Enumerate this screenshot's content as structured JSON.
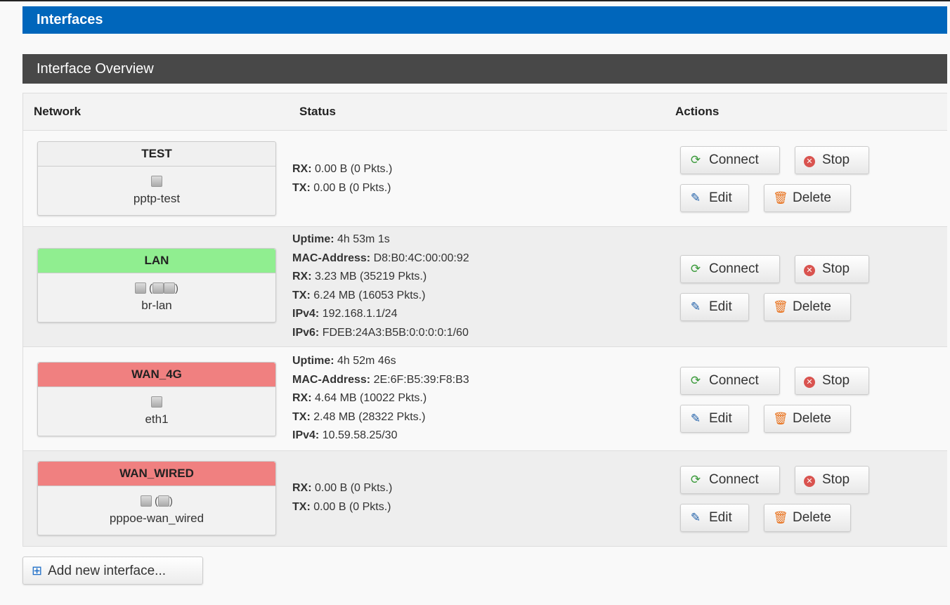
{
  "page": {
    "title": "Interfaces"
  },
  "section": {
    "title": "Interface Overview"
  },
  "table": {
    "headers": {
      "network": "Network",
      "status": "Status",
      "actions": "Actions"
    }
  },
  "colors": {
    "lan_header": "#90ee90",
    "wan_header": "#f08080",
    "neutral_header": "#f0f0f0",
    "page_header": "#0066bb"
  },
  "actions": {
    "connect": "Connect",
    "stop": "Stop",
    "edit": "Edit",
    "delete": "Delete"
  },
  "labels": {
    "uptime": "Uptime:",
    "mac": "MAC-Address:",
    "rx": "RX:",
    "tx": "TX:",
    "ipv4": "IPv4:",
    "ipv6": "IPv6:"
  },
  "interfaces": [
    {
      "name": "TEST",
      "device": "pptp-test",
      "rx": "0.00 B (0 Pkts.)",
      "tx": "0.00 B (0 Pkts.)"
    },
    {
      "name": "LAN",
      "device": "br-lan",
      "uptime": "4h 53m 1s",
      "mac": "D8:B0:4C:00:00:92",
      "rx": "3.23 MB (35219 Pkts.)",
      "tx": "6.24 MB (16053 Pkts.)",
      "ipv4": "192.168.1.1/24",
      "ipv6": "FDEB:24A3:B5B:0:0:0:0:1/60"
    },
    {
      "name": "WAN_4G",
      "device": "eth1",
      "uptime": "4h 52m 46s",
      "mac": "2E:6F:B5:39:F8:B3",
      "rx": "4.64 MB (10022 Pkts.)",
      "tx": "2.48 MB (28322 Pkts.)",
      "ipv4": "10.59.58.25/30"
    },
    {
      "name": "WAN_WIRED",
      "device": "pppoe-wan_wired",
      "rx": "0.00 B (0 Pkts.)",
      "tx": "0.00 B (0 Pkts.)"
    }
  ],
  "add_button": {
    "label": "Add new interface..."
  }
}
